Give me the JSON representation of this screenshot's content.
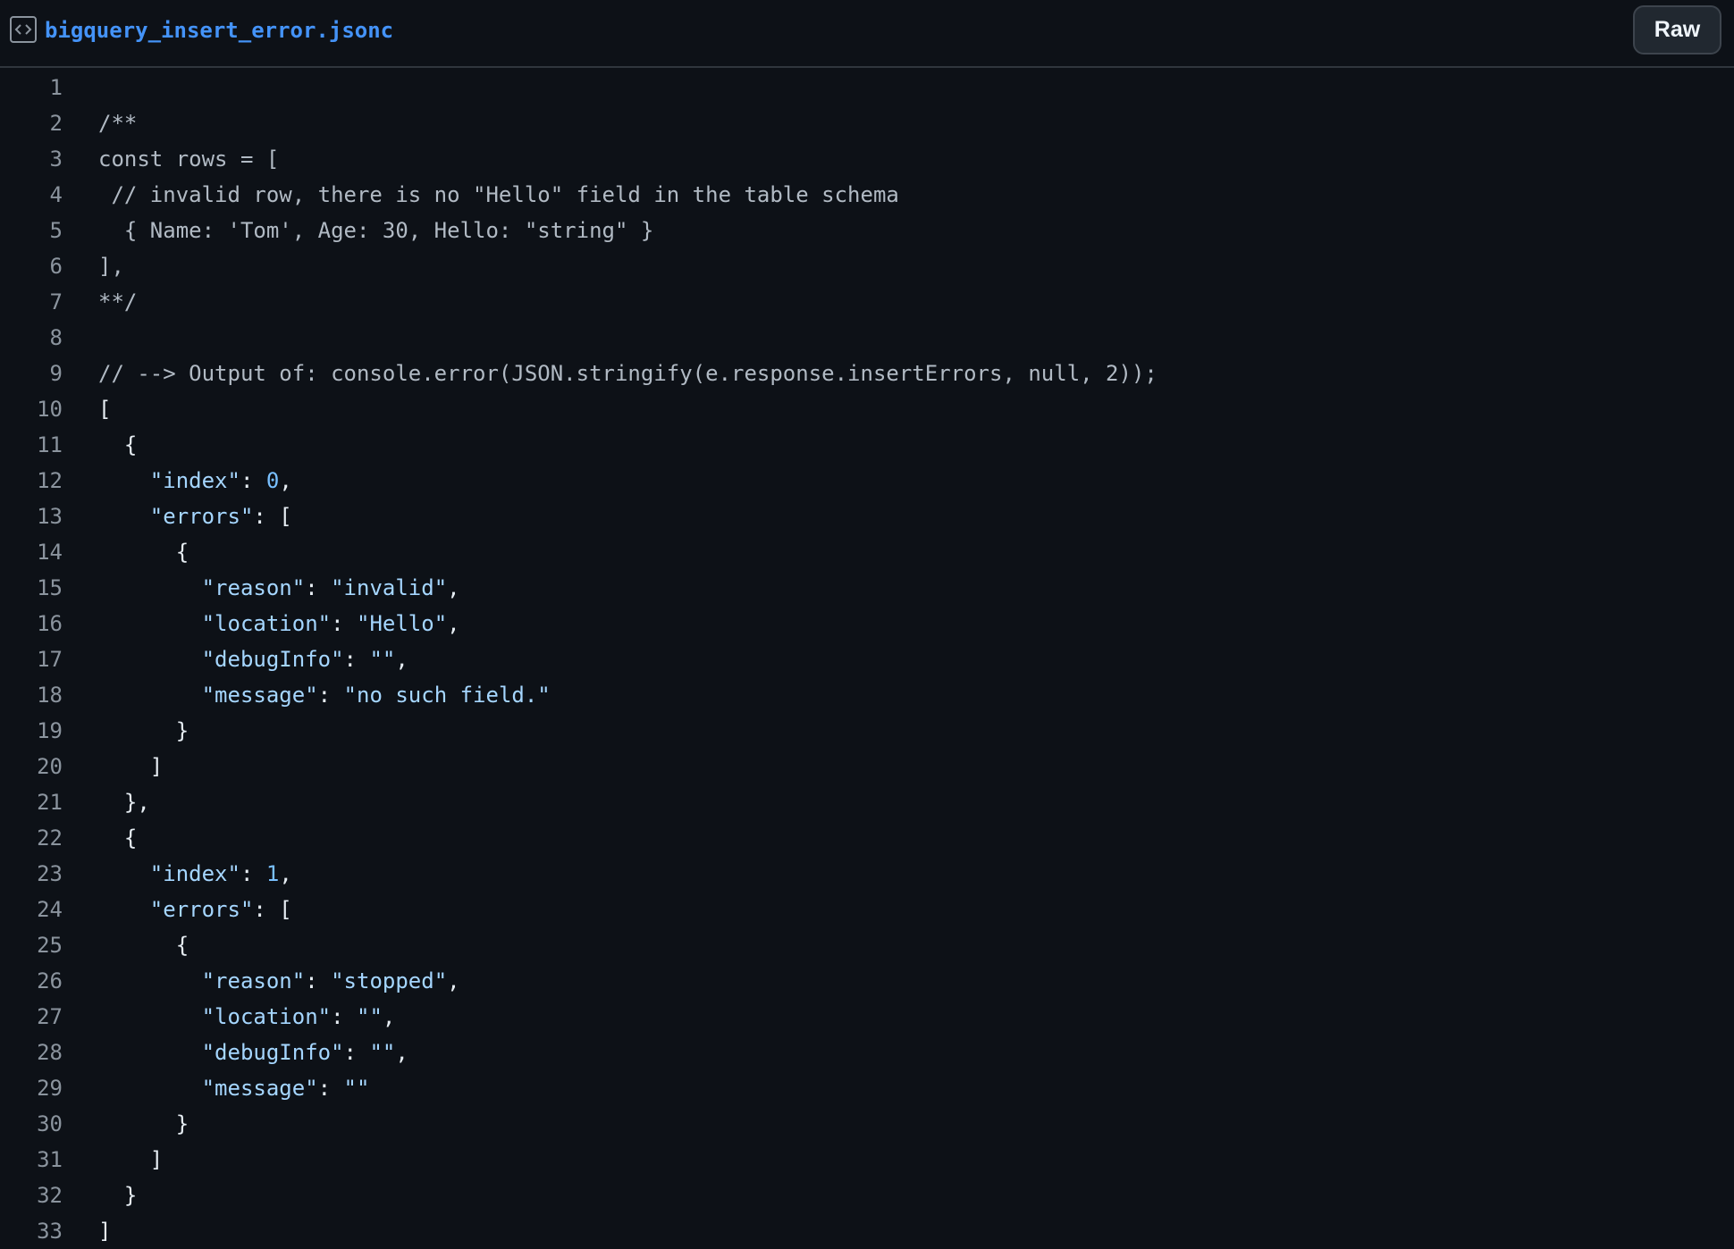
{
  "header": {
    "filename": "bigquery_insert_error.jsonc",
    "raw_label": "Raw",
    "icon": "code-file-icon"
  },
  "code": {
    "lines": [
      {
        "n": "1",
        "t": []
      },
      {
        "n": "2",
        "t": [
          {
            "c": "c",
            "v": "/**"
          }
        ]
      },
      {
        "n": "3",
        "t": [
          {
            "c": "c",
            "v": "const rows = ["
          }
        ]
      },
      {
        "n": "4",
        "t": [
          {
            "c": "c",
            "v": " // invalid row, there is no \"Hello\" field in the table schema"
          }
        ]
      },
      {
        "n": "5",
        "t": [
          {
            "c": "c",
            "v": "  { Name: 'Tom', Age: 30, Hello: \"string\" }"
          }
        ]
      },
      {
        "n": "6",
        "t": [
          {
            "c": "c",
            "v": "],"
          }
        ]
      },
      {
        "n": "7",
        "t": [
          {
            "c": "c",
            "v": "**/"
          }
        ]
      },
      {
        "n": "8",
        "t": []
      },
      {
        "n": "9",
        "t": [
          {
            "c": "c",
            "v": "// --> Output of: console.error(JSON.stringify(e.response.insertErrors, null, 2));"
          }
        ]
      },
      {
        "n": "10",
        "t": [
          {
            "c": "p",
            "v": "["
          }
        ]
      },
      {
        "n": "11",
        "t": [
          {
            "c": "p",
            "v": "  {"
          }
        ]
      },
      {
        "n": "12",
        "t": [
          {
            "c": "p",
            "v": "    "
          },
          {
            "c": "k",
            "v": "\"index\""
          },
          {
            "c": "p",
            "v": ": "
          },
          {
            "c": "n",
            "v": "0"
          },
          {
            "c": "p",
            "v": ","
          }
        ]
      },
      {
        "n": "13",
        "t": [
          {
            "c": "p",
            "v": "    "
          },
          {
            "c": "k",
            "v": "\"errors\""
          },
          {
            "c": "p",
            "v": ": ["
          }
        ]
      },
      {
        "n": "14",
        "t": [
          {
            "c": "p",
            "v": "      {"
          }
        ]
      },
      {
        "n": "15",
        "t": [
          {
            "c": "p",
            "v": "        "
          },
          {
            "c": "k",
            "v": "\"reason\""
          },
          {
            "c": "p",
            "v": ": "
          },
          {
            "c": "s",
            "v": "\"invalid\""
          },
          {
            "c": "p",
            "v": ","
          }
        ]
      },
      {
        "n": "16",
        "t": [
          {
            "c": "p",
            "v": "        "
          },
          {
            "c": "k",
            "v": "\"location\""
          },
          {
            "c": "p",
            "v": ": "
          },
          {
            "c": "s",
            "v": "\"Hello\""
          },
          {
            "c": "p",
            "v": ","
          }
        ]
      },
      {
        "n": "17",
        "t": [
          {
            "c": "p",
            "v": "        "
          },
          {
            "c": "k",
            "v": "\"debugInfo\""
          },
          {
            "c": "p",
            "v": ": "
          },
          {
            "c": "s",
            "v": "\"\""
          },
          {
            "c": "p",
            "v": ","
          }
        ]
      },
      {
        "n": "18",
        "t": [
          {
            "c": "p",
            "v": "        "
          },
          {
            "c": "k",
            "v": "\"message\""
          },
          {
            "c": "p",
            "v": ": "
          },
          {
            "c": "s",
            "v": "\"no such field.\""
          }
        ]
      },
      {
        "n": "19",
        "t": [
          {
            "c": "p",
            "v": "      }"
          }
        ]
      },
      {
        "n": "20",
        "t": [
          {
            "c": "p",
            "v": "    ]"
          }
        ]
      },
      {
        "n": "21",
        "t": [
          {
            "c": "p",
            "v": "  },"
          }
        ]
      },
      {
        "n": "22",
        "t": [
          {
            "c": "p",
            "v": "  {"
          }
        ]
      },
      {
        "n": "23",
        "t": [
          {
            "c": "p",
            "v": "    "
          },
          {
            "c": "k",
            "v": "\"index\""
          },
          {
            "c": "p",
            "v": ": "
          },
          {
            "c": "n",
            "v": "1"
          },
          {
            "c": "p",
            "v": ","
          }
        ]
      },
      {
        "n": "24",
        "t": [
          {
            "c": "p",
            "v": "    "
          },
          {
            "c": "k",
            "v": "\"errors\""
          },
          {
            "c": "p",
            "v": ": ["
          }
        ]
      },
      {
        "n": "25",
        "t": [
          {
            "c": "p",
            "v": "      {"
          }
        ]
      },
      {
        "n": "26",
        "t": [
          {
            "c": "p",
            "v": "        "
          },
          {
            "c": "k",
            "v": "\"reason\""
          },
          {
            "c": "p",
            "v": ": "
          },
          {
            "c": "s",
            "v": "\"stopped\""
          },
          {
            "c": "p",
            "v": ","
          }
        ]
      },
      {
        "n": "27",
        "t": [
          {
            "c": "p",
            "v": "        "
          },
          {
            "c": "k",
            "v": "\"location\""
          },
          {
            "c": "p",
            "v": ": "
          },
          {
            "c": "s",
            "v": "\"\""
          },
          {
            "c": "p",
            "v": ","
          }
        ]
      },
      {
        "n": "28",
        "t": [
          {
            "c": "p",
            "v": "        "
          },
          {
            "c": "k",
            "v": "\"debugInfo\""
          },
          {
            "c": "p",
            "v": ": "
          },
          {
            "c": "s",
            "v": "\"\""
          },
          {
            "c": "p",
            "v": ","
          }
        ]
      },
      {
        "n": "29",
        "t": [
          {
            "c": "p",
            "v": "        "
          },
          {
            "c": "k",
            "v": "\"message\""
          },
          {
            "c": "p",
            "v": ": "
          },
          {
            "c": "s",
            "v": "\"\""
          }
        ]
      },
      {
        "n": "30",
        "t": [
          {
            "c": "p",
            "v": "      }"
          }
        ]
      },
      {
        "n": "31",
        "t": [
          {
            "c": "p",
            "v": "    ]"
          }
        ]
      },
      {
        "n": "32",
        "t": [
          {
            "c": "p",
            "v": "  }"
          }
        ]
      },
      {
        "n": "33",
        "t": [
          {
            "c": "p",
            "v": "]"
          }
        ]
      }
    ]
  }
}
